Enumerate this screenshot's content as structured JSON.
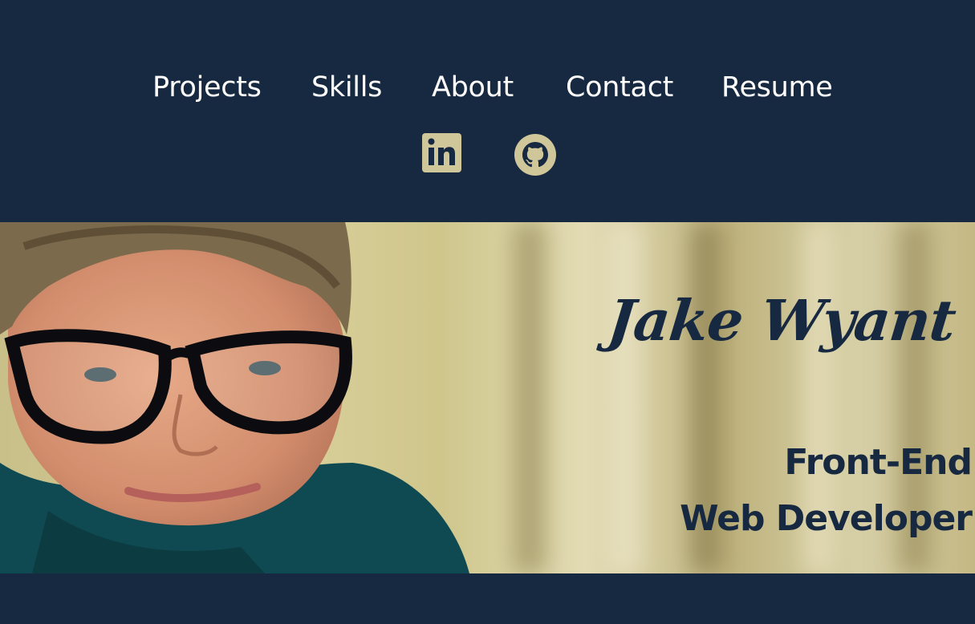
{
  "nav": {
    "items": [
      {
        "label": "Projects"
      },
      {
        "label": "Skills"
      },
      {
        "label": "About"
      },
      {
        "label": "Contact"
      },
      {
        "label": "Resume"
      }
    ]
  },
  "social": {
    "linkedin_icon": "linkedin-icon",
    "github_icon": "github-icon"
  },
  "hero": {
    "name": "Jake Wyant",
    "role_line1": "Front-End",
    "role_line2": "Web Developer"
  },
  "colors": {
    "background": "#172940",
    "nav_text": "#ffffff",
    "icon": "#cfc79a",
    "hero_text": "#172940"
  }
}
